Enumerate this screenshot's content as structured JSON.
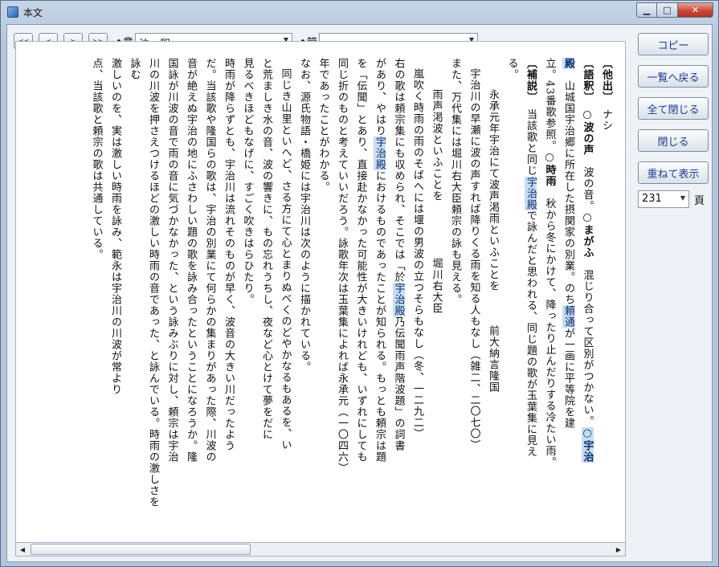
{
  "window": {
    "title": "本文"
  },
  "toolbar": {
    "first_label": "<<",
    "prev_label": "<",
    "next_label": ">",
    "last_label": ">>",
    "chapter_label": "◆章",
    "chapter_value": "注　釈",
    "section_label": "◆節",
    "section_value": ""
  },
  "side": {
    "copy": "コピー",
    "to_list": "一覧へ戻る",
    "close_all": "全て閉じる",
    "close": "閉じる",
    "cascade": "重ねて表示",
    "page_value": "231",
    "page_unit": "頁"
  },
  "text": {
    "l01_a": "〔他出〕",
    "l01_b": "　ナシ",
    "l02_a": "〔語釈〕",
    "l02_b": "　○波の声",
    "l02_c": "　波の音。",
    "l02_d": "○まがふ",
    "l02_e": "　混じり合って区別がつかない。",
    "l02_f": "○宇治",
    "l03_a": "殿",
    "l03_b": "　山城国宇治郷に所在した摂関家の別業。のち",
    "l03_c": "頼通",
    "l03_d": "が一画に平等院を建",
    "l04_a": "立。43番歌参照。",
    "l04_b": "○時雨",
    "l04_c": "　秋から冬にかけて、降ったり止んだりする冷たい雨。",
    "l05_a": "〔補説〕",
    "l05_b": "　当該歌と同じ",
    "l05_c": "宇治殿",
    "l05_d": "で詠んだと思われる、同じ題の歌が玉葉集に見え",
    "l06": "る。",
    "l07": "永承元年宇治にて波声渇雨といふことを　　　前大納言隆国",
    "l08": "宇治川の早瀬に波の声すれば降りくる雨を知る人もなし（雑二、二〇七〇）",
    "l09": "また、万代集には堀川右大臣頼宗の詠も見える。",
    "l10": "雨声渇波といふことを　　　　　堀川右大臣",
    "l11": "嵐吹く時雨の雨のそばへには堰の男波の立つそらもなし（冬、一二九二）",
    "l12_a": "右の歌は頼宗集にも収められ、そこでは「於",
    "l12_b": "宇治殿",
    "l12_c": "乃伝聞雨声階波題」の詞書",
    "l13_a": "があり、やはり",
    "l13_b": "宇治殿",
    "l13_c": "におけるものであったことが知られる。もっとも頼宗は題",
    "l14": "を「伝聞」とあり、直接赴かなかった可能性が大きいけれども、いずれにしても",
    "l15": "同じ折のものと考えていいだろう。詠歌年次は玉葉集によれば永承元（一〇四六）",
    "l16": "年であったことがわかる。",
    "l17": "なお、源氏物語・橋姫には宇治川は次のように描かれている。",
    "l18": "同じき山里といへど、さる方にて心とまりぬべくのどやかなるもあるを、い",
    "l19": "と荒ましき水の音、波の響きに、もの忘れうちし、夜など心とけて夢をだに",
    "l20": "見るべきほどもなげに、すごく吹きはらひたり。",
    "l21": "時雨が降らずとも、宇治川は流れそのものが早く、波音の大きい川だったよう",
    "l22": "だ。当該歌や隆国らの歌は、宇治の別業にて何らかの集まりがあった際、川波の",
    "l23": "音が絶えぬ宇治の地にふさわしい題の歌を詠み合ったということになろうか。隆",
    "l24": "国詠が川波の音で雨の音に気づかなかった、という詠みぶりに対し、頼宗は宇治",
    "l25": "川の川波を押さえつけるほどの激しい時雨の音であった、と詠んでいる。時雨の激しさを詠む",
    "l26": "激しいのを、実は激しい時雨を詠み、範永は宇治川の川波が常より",
    "l27": "点、当該歌と頼宗の歌は共通している。"
  }
}
